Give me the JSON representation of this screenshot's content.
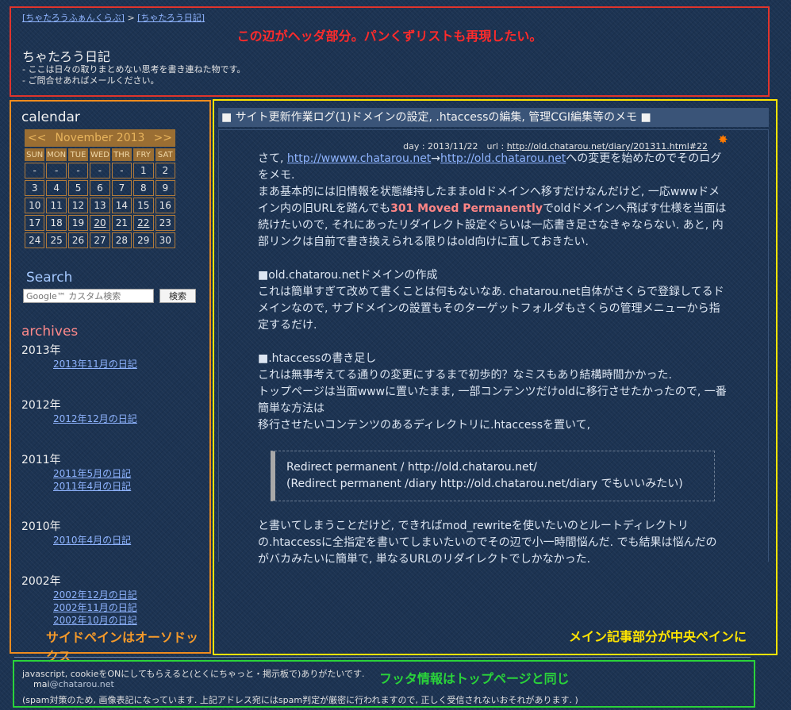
{
  "header": {
    "breadcrumb": {
      "home": "[ちゃたろうふぁんくらぶ]",
      "separator": ">",
      "current": "[ちゃたろう日記]"
    },
    "annotation": "この辺がヘッダ部分。パンくずリストも再現したい。",
    "site_title": "ちゃたろう日記",
    "description": [
      "- ここは日々の取りまとめない思考を書き連ねた物です。",
      "- ご問合せあればメールください。"
    ]
  },
  "sidebar": {
    "calendar": {
      "heading": "calendar",
      "prev": "<<",
      "month": "November 2013",
      "next": ">>",
      "weekdays": [
        "SUN",
        "MON",
        "TUE",
        "WED",
        "THR",
        "FRY",
        "SAT"
      ],
      "weeks": [
        [
          "-",
          "-",
          "-",
          "-",
          "-",
          "1",
          "2"
        ],
        [
          "3",
          "4",
          "5",
          "6",
          "7",
          "8",
          "9"
        ],
        [
          "10",
          "11",
          "12",
          "13",
          "14",
          "15",
          "16"
        ],
        [
          "17",
          "18",
          "19",
          "20",
          "21",
          "22",
          "23"
        ],
        [
          "24",
          "25",
          "26",
          "27",
          "28",
          "29",
          "30"
        ]
      ],
      "linked_days": [
        "20",
        "22"
      ]
    },
    "search": {
      "heading": "Search",
      "placeholder": "Google™ カスタム検索",
      "button": "検索"
    },
    "archives": {
      "heading": "archives",
      "years": [
        {
          "year": "2013年",
          "links": [
            "2013年11月の日記"
          ]
        },
        {
          "year": "2012年",
          "links": [
            "2012年12月の日記"
          ]
        },
        {
          "year": "2011年",
          "links": [
            "2011年5月の日記",
            "2011年4月の日記"
          ]
        },
        {
          "year": "2010年",
          "links": [
            "2010年4月の日記"
          ]
        },
        {
          "year": "2002年",
          "links": [
            "2002年12月の日記",
            "2002年11月の日記",
            "2002年10月の日記"
          ]
        }
      ]
    },
    "annotation": "サイドペインはオーソドックス"
  },
  "article": {
    "title": "■ サイト更新作業ログ(1)ドメインの設定, .htaccessの編集, 管理CGI編集等のメモ ■",
    "meta_prefix": "day : 2013/11/22　url : ",
    "meta_url": "http://old.chatarou.net/diary/201311.html#22",
    "p1_a": "さて, ",
    "p1_link1": "http://wwww.chatarou.net",
    "p1_arrow": "→",
    "p1_link2": "http://old.chatarou.net",
    "p1_b": "への変更を始めたのでそのログをメモ.",
    "p2_a": "まあ基本的には旧情報を状態維持したままoldドメインへ移すだけなんだけど, 一応wwwドメイン内の旧URLを踏んでも",
    "p2_strong": "301 Moved Permanently",
    "p2_b": "でoldドメインへ飛ばす仕様を当面は続けたいので, それにあったリダイレクト設定ぐらいは一応書き足さなきゃならない. あと, 内部リンクは自前で書き換えられる限りはold向けに直しておきたい.",
    "s1_heading": "■old.chatarou.netドメインの作成",
    "s1_text": "これは簡単すぎて改めて書くことは何もないなあ. chatarou.net自体がさくらで登録してるドメインなので, サブドメインの設置もそのターゲットフォルダもさくらの管理メニューから指定するだけ.",
    "s2_heading": "■.htaccessの書き足し",
    "s2_line1": "これは無事考えてる通りの変更にするまで初歩的？なミスもあり結構時間かかった.",
    "s2_line2": "トップページは当面wwwに置いたまま, 一部コンテンツだけoldに移行させたかったので, 一番簡単な方法は",
    "s2_line3": "移行させたいコンテンツのあるディレクトリに.htaccessを置いて,",
    "code_line1": "Redirect permanent / http://old.chatarou.net/",
    "code_line2": "(Redirect permanent /diary http://old.chatarou.net/diary でもいいみたい)",
    "s2_after": "と書いてしまうことだけど, できればmod_rewriteを使いたいのとルートディレクトリの.htaccessに全指定を書いてしまいたいのでその辺で小一時間悩んだ. でも結果は悩んだのがバカみたいに簡単で, 単なるURLのリダイレクトでしかなかった."
  },
  "main_annotation": "メイン記事部分が中央ペインに",
  "footer": {
    "line1": "javascript, cookieをONにしてもらえると(とくにちゃっと・掲示板で)ありがたいです.",
    "mail_user": "mai",
    "mail_domain": "@chatarou.net",
    "line3": "(spam対策のため, 画像表記になっています. 上記アドレス宛にはspam判定が厳密に行われますので, 正しく受信されないおそれがあります. )",
    "annotation": "フッタ情報はトップページと同じ"
  },
  "colors": {
    "header_box": "#e0342c",
    "sidebar_box": "#f08c1e",
    "main_box": "#ffe400",
    "footer_box": "#2ad33a"
  }
}
